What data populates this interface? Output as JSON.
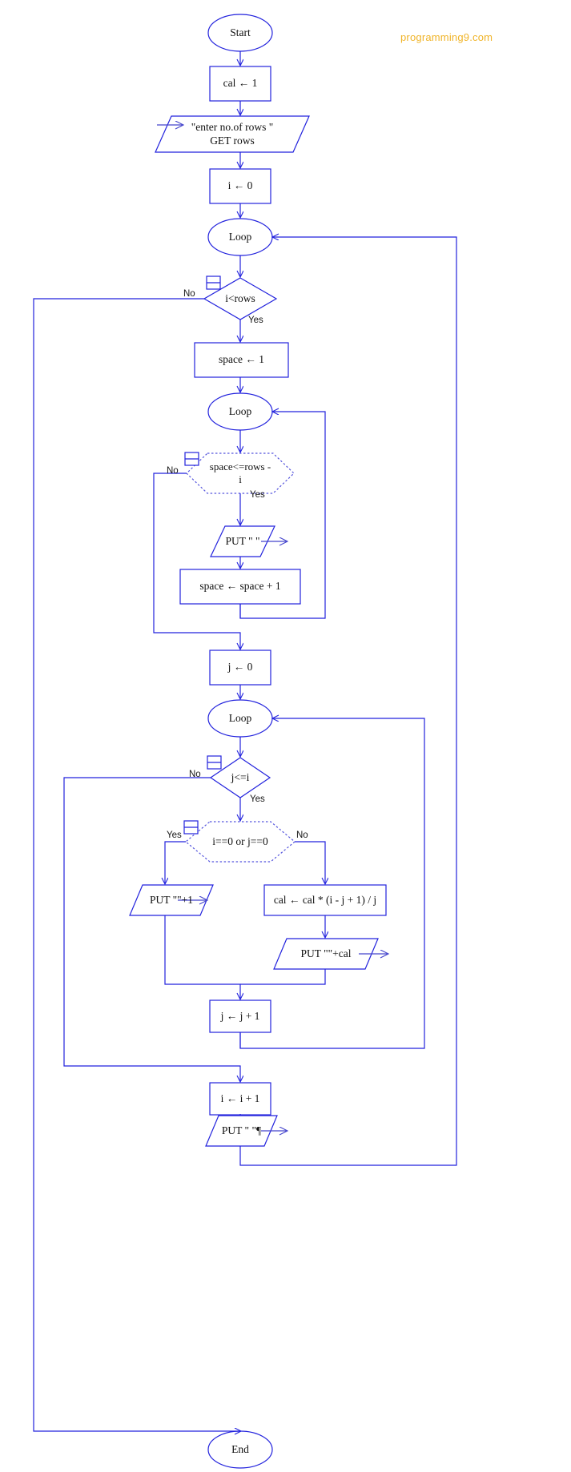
{
  "meta": {
    "watermark": "programming9.com",
    "stroke_color": "#2222dd",
    "text_color": "#101010",
    "watermark_color": "#f0b429",
    "background": "#ffffff"
  },
  "nodes": {
    "start": "Start",
    "cal_init": "cal ← 1",
    "input_rows": "\"enter no.of rows \"\nGET rows",
    "input_rows_line1": "\"enter no.of rows \"",
    "input_rows_line2": "GET rows",
    "i_init": "i ← 0",
    "loop_outer": "Loop",
    "cond_i_rows": "i<rows",
    "space_init": "space ← 1",
    "loop_space": "Loop",
    "cond_space": "space<=rows - i",
    "cond_space_line1": "space<=rows -",
    "cond_space_line2": "i",
    "put_space": "PUT \" \"",
    "space_inc": "space ← space + 1",
    "j_init": "j ← 0",
    "loop_j": "Loop",
    "cond_j_i": "j<=i",
    "cond_i0_j0": "i==0 or j==0",
    "put_one": "PUT \"\"+1",
    "cal_calc": "cal ← cal * (i - j + 1) / j",
    "put_cal": "PUT \"\"+cal",
    "j_inc": "j ← j + 1",
    "i_inc": "i ← i + 1",
    "put_newline": "PUT \" \"¶",
    "end": "End"
  },
  "edge_labels": {
    "i_rows_no": "No",
    "i_rows_yes": "Yes",
    "space_no": "No",
    "space_yes": "Yes",
    "j_i_no": "No",
    "j_i_yes": "Yes",
    "i0j0_yes": "Yes",
    "i0j0_no": "No"
  }
}
